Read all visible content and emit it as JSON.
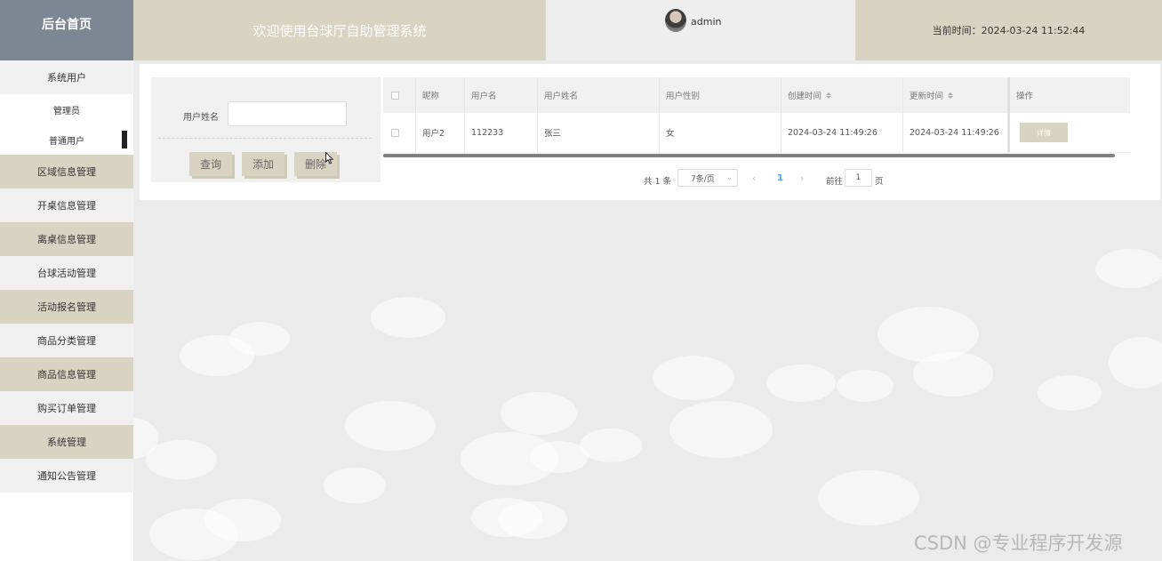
{
  "header": {
    "brand": "后台首页",
    "welcome": "欢迎使用台球厅自助管理系统",
    "username": "admin",
    "current_time": "当前时间：2024-03-24 11:52:44"
  },
  "sidebar": {
    "system_user": "系统用户",
    "sub_items": [
      "管理员",
      "普通用户"
    ],
    "items": [
      "区域信息管理",
      "开桌信息管理",
      "离桌信息管理",
      "台球活动管理",
      "活动报名管理",
      "商品分类管理",
      "商品信息管理",
      "购买订单管理",
      "系统管理",
      "通知公告管理"
    ]
  },
  "search": {
    "label": "用户姓名",
    "value": "",
    "query_button": "查询",
    "add_button": "添加",
    "delete_button": "删除"
  },
  "table": {
    "headers": [
      "昵称",
      "用户名",
      "用户姓名",
      "用户性别",
      "创建时间",
      "更新时间",
      "操作"
    ],
    "rows": [
      {
        "nickname": "用户2",
        "username": "112233",
        "realname": "张三",
        "gender": "女",
        "created": "2024-03-24 11:49:26",
        "updated": "2024-03-24 11:49:26",
        "action": "详情"
      }
    ]
  },
  "pager": {
    "total": "共 1 条",
    "page_size": "7条/页",
    "current_page": "1",
    "goto_label": "前往",
    "goto_value": "1",
    "page_unit": "页"
  },
  "watermark": "CSDN @专业程序开发源"
}
